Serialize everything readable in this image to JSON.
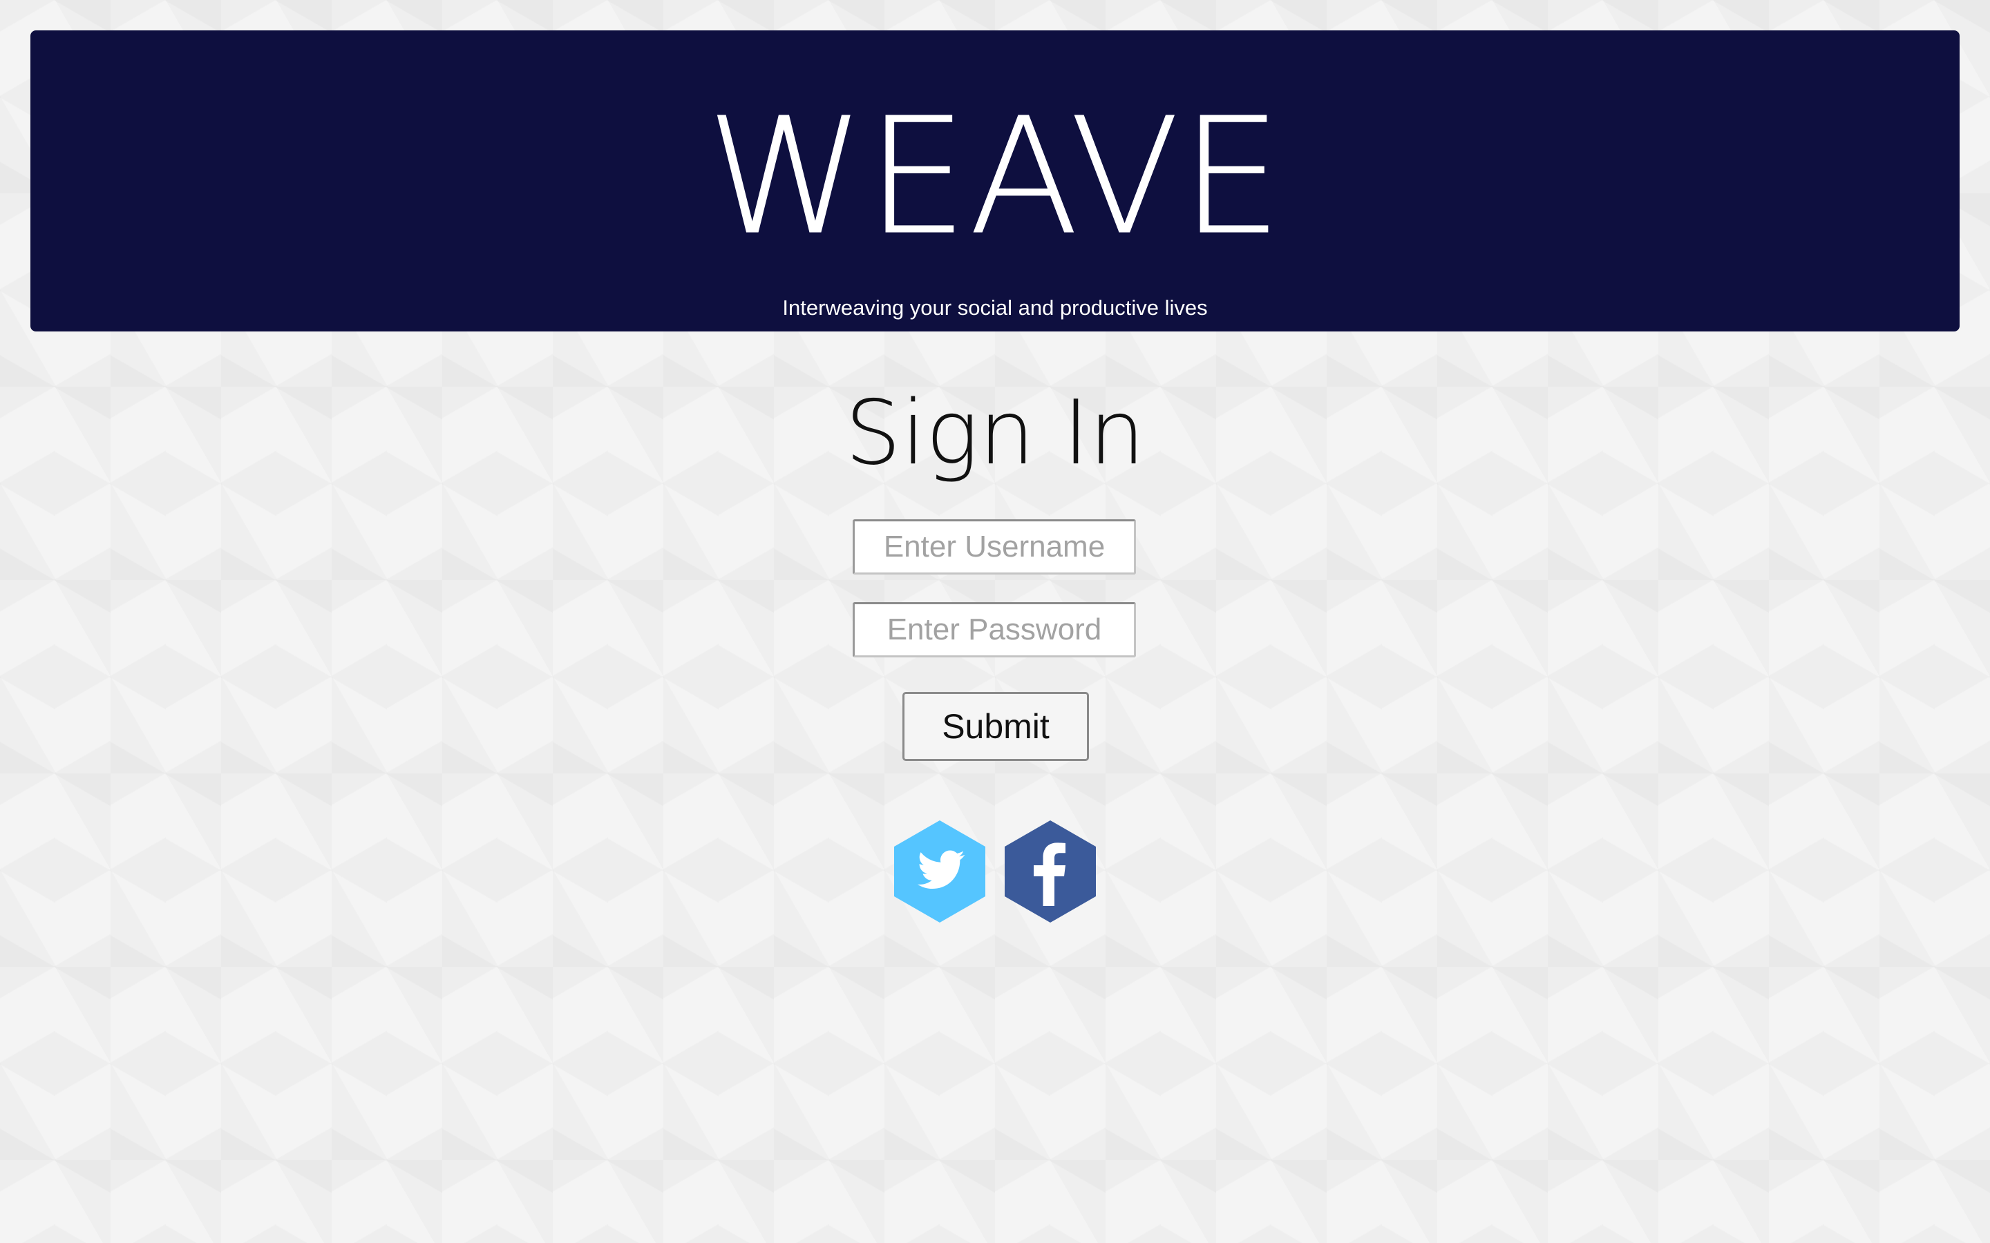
{
  "brand": {
    "name": "WEAVE",
    "tagline": "Interweaving your social and productive lives",
    "banner_color": "#0e0f3f"
  },
  "signin": {
    "title": "Sign In",
    "username_placeholder": "Enter Username",
    "password_placeholder": "Enter Password",
    "submit_label": "Submit"
  },
  "social": {
    "twitter": {
      "icon": "twitter-bird-icon",
      "color": "#55c5ff"
    },
    "facebook": {
      "icon": "facebook-f-icon",
      "color": "#3b5a9a"
    }
  }
}
